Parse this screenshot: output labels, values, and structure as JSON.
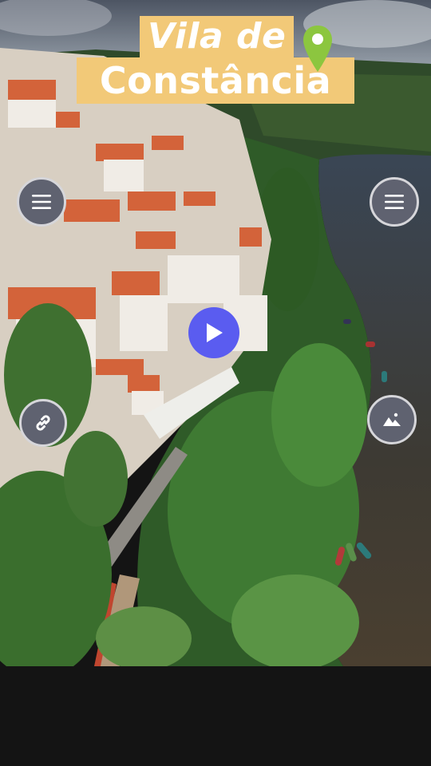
{
  "title": {
    "line1": "Vila de",
    "line2": "Constância"
  },
  "colors": {
    "title_bg": "#f2c978",
    "title_text": "#ffffff",
    "pin": "#8cc63f",
    "play_button": "#5a5cf0",
    "round_button": "#5f6270",
    "bottom_bar": "#141414"
  },
  "icons": {
    "pin": "location-pin-icon",
    "menu_left": "hamburger-menu-icon",
    "menu_right": "hamburger-menu-icon",
    "link": "link-icon",
    "image": "image-icon",
    "play": "play-icon"
  },
  "background": "aerial-photo-town-by-river"
}
